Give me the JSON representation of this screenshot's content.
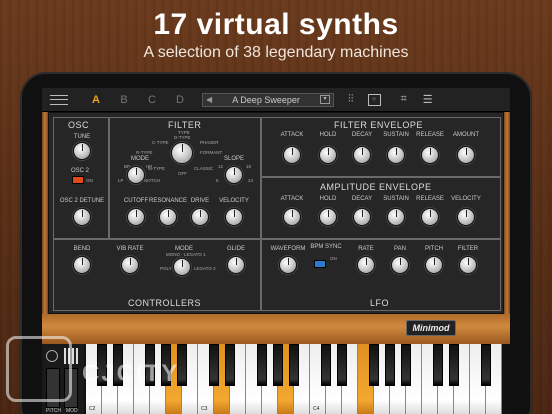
{
  "headline": "17 virtual synths",
  "subline": "A selection of 38 legendary machines",
  "toolbar": {
    "slots": [
      "A",
      "B",
      "C",
      "D"
    ],
    "preset_name": "A Deep Sweeper",
    "prev": "◀",
    "next": "▶"
  },
  "osc": {
    "title": "OSC",
    "tune": "TUNE",
    "osc2": "OSC 2",
    "on": "ON",
    "detune": "OSC 2 DETUNE"
  },
  "filter": {
    "title": "FILTER",
    "type": "TYPE",
    "dtype": "D-TYPE",
    "ctype": "C-TYPE",
    "phaser": "PHASER",
    "rtype": "R-TYPE",
    "formant": "FORMANT",
    "mtype": "M-TYPE",
    "classic": "CLASSIC",
    "off": "OFF",
    "mode": "MODE",
    "bp": "BP",
    "hp": "HP",
    "lp": "LP",
    "notch": "NOTCH",
    "slope": "SLOPE",
    "s12": "12",
    "s18": "18",
    "s6": "6",
    "s24": "24",
    "cutoff": "CUTOFF",
    "resonance": "RESONANCE",
    "drive": "DRIVE",
    "velocity": "VELOCITY"
  },
  "filter_env": {
    "title": "FILTER ENVELOPE",
    "labels": [
      "ATTACK",
      "HOLD",
      "DECAY",
      "SUSTAIN",
      "RELEASE",
      "AMOUNT"
    ]
  },
  "amp_env": {
    "title": "AMPLITUDE ENVELOPE",
    "labels": [
      "ATTACK",
      "HOLD",
      "DECAY",
      "SUSTAIN",
      "RELEASE",
      "VELOCITY"
    ]
  },
  "controllers": {
    "title": "CONTROLLERS",
    "bend": "BEND",
    "vib_rate": "VIB RATE",
    "mode": "MODE",
    "mono_legato": "MONO - LEGATO 1",
    "poly": "POLY",
    "legato2": "LEGATO 2",
    "glide": "GLIDE"
  },
  "lfo": {
    "title": "LFO",
    "waveform": "WAVEFORM",
    "bpm_sync": "BPM SYNC",
    "on": "ON",
    "labels": [
      "RATE",
      "PAN",
      "PITCH",
      "FILTER"
    ]
  },
  "logo": "Minimod",
  "keyboard": {
    "pitch": "PITCH",
    "mod": "MOD",
    "c2": "C2",
    "c3": "C3",
    "c4": "C4"
  },
  "watermark": "CJCITY",
  "colors": {
    "accent": "#f0a020",
    "osc2_toggle": "#e04a20",
    "sync_toggle": "#2a7ad0"
  }
}
